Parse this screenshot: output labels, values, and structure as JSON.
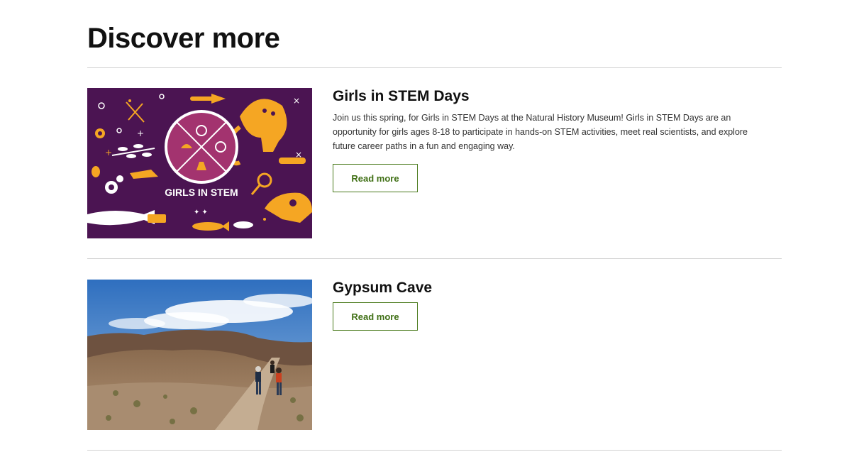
{
  "section": {
    "heading": "Discover more"
  },
  "cards": [
    {
      "title": "Girls in STEM Days",
      "description": "Join us this spring, for Girls in STEM Days at the Natural History Museum! Girls in STEM Days are an opportunity for girls ages 8-18 to participate in hands-on STEM activities, meet real scientists, and explore future career paths in a fun and engaging way.",
      "button_label": "Read more",
      "image_label": "GIRLS IN STEM",
      "image_icon": "girls-in-stem-illustration"
    },
    {
      "title": "Gypsum Cave",
      "button_label": "Read more",
      "image_icon": "desert-hike-photo"
    }
  ],
  "colors": {
    "accent_green": "#3f6f14",
    "divider": "#d2d2d2",
    "stem_purple": "#4b1452",
    "stem_orange": "#f5a623",
    "stem_magenta": "#a3336f"
  }
}
